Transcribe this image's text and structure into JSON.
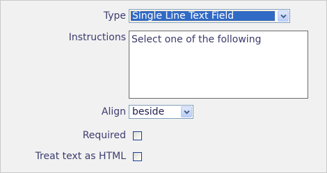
{
  "form": {
    "type": {
      "label": "Type",
      "value": "Single Line Text Field"
    },
    "instructions": {
      "label": "Instructions",
      "value": "Select one of the following"
    },
    "align": {
      "label": "Align",
      "value": "beside"
    },
    "required": {
      "label": "Required",
      "checked": false
    },
    "treat_html": {
      "label": "Treat text as HTML",
      "checked": false
    }
  },
  "colors": {
    "selection": "#316ac5",
    "label_text": "#3c3c70",
    "background": "#f1f1f1"
  },
  "icons": {
    "dropdown": "chevron-down-icon"
  }
}
